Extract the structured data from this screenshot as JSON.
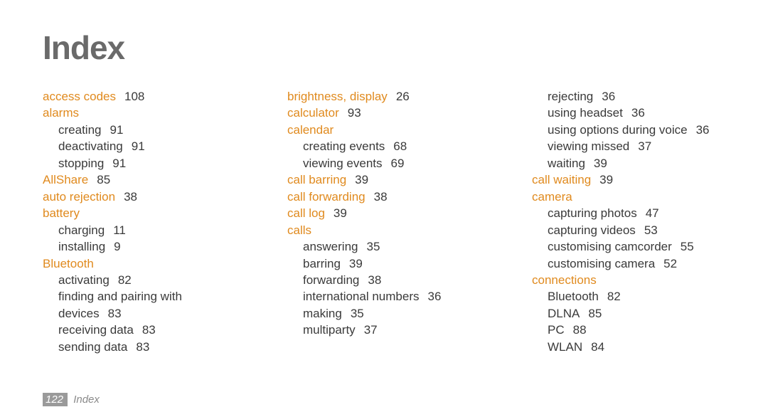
{
  "title": "Index",
  "footer": {
    "page": "122",
    "label": "Index"
  },
  "columns": [
    [
      {
        "type": "topic",
        "label": "access codes",
        "page": "108"
      },
      {
        "type": "topic",
        "label": "alarms"
      },
      {
        "type": "sub",
        "label": "creating",
        "page": "91"
      },
      {
        "type": "sub",
        "label": "deactivating",
        "page": "91"
      },
      {
        "type": "sub",
        "label": "stopping",
        "page": "91"
      },
      {
        "type": "topic",
        "label": "AllShare",
        "page": "85"
      },
      {
        "type": "topic",
        "label": "auto rejection",
        "page": "38"
      },
      {
        "type": "topic",
        "label": "battery"
      },
      {
        "type": "sub",
        "label": "charging",
        "page": "11"
      },
      {
        "type": "sub",
        "label": "installing",
        "page": "9"
      },
      {
        "type": "topic",
        "label": "Bluetooth"
      },
      {
        "type": "sub",
        "label": "activating",
        "page": "82"
      },
      {
        "type": "sub",
        "label": "finding and pairing with devices",
        "page": "83",
        "wrap": true
      },
      {
        "type": "sub",
        "label": "receiving data",
        "page": "83"
      },
      {
        "type": "sub",
        "label": "sending data",
        "page": "83"
      }
    ],
    [
      {
        "type": "topic",
        "label": "brightness, display",
        "page": "26"
      },
      {
        "type": "topic",
        "label": "calculator",
        "page": "93"
      },
      {
        "type": "topic",
        "label": "calendar"
      },
      {
        "type": "sub",
        "label": "creating events",
        "page": "68"
      },
      {
        "type": "sub",
        "label": "viewing events",
        "page": "69"
      },
      {
        "type": "topic",
        "label": "call barring",
        "page": "39"
      },
      {
        "type": "topic",
        "label": "call forwarding",
        "page": "38"
      },
      {
        "type": "topic",
        "label": "call log",
        "page": "39"
      },
      {
        "type": "topic",
        "label": "calls"
      },
      {
        "type": "sub",
        "label": "answering",
        "page": "35"
      },
      {
        "type": "sub",
        "label": "barring",
        "page": "39"
      },
      {
        "type": "sub",
        "label": "forwarding",
        "page": "38"
      },
      {
        "type": "sub",
        "label": "international numbers",
        "page": "36"
      },
      {
        "type": "sub",
        "label": "making",
        "page": "35"
      },
      {
        "type": "sub",
        "label": "multiparty",
        "page": "37"
      }
    ],
    [
      {
        "type": "sub",
        "label": "rejecting",
        "page": "36"
      },
      {
        "type": "sub",
        "label": "using headset",
        "page": "36"
      },
      {
        "type": "sub",
        "label": "using options during voice",
        "page": "36"
      },
      {
        "type": "sub",
        "label": "viewing missed",
        "page": "37"
      },
      {
        "type": "sub",
        "label": "waiting",
        "page": "39"
      },
      {
        "type": "topic",
        "label": "call waiting",
        "page": "39"
      },
      {
        "type": "topic",
        "label": "camera"
      },
      {
        "type": "sub",
        "label": "capturing photos",
        "page": "47"
      },
      {
        "type": "sub",
        "label": "capturing videos",
        "page": "53"
      },
      {
        "type": "sub",
        "label": "customising camcorder",
        "page": "55"
      },
      {
        "type": "sub",
        "label": "customising camera",
        "page": "52"
      },
      {
        "type": "topic",
        "label": "connections"
      },
      {
        "type": "sub",
        "label": "Bluetooth",
        "page": "82"
      },
      {
        "type": "sub",
        "label": "DLNA",
        "page": "85"
      },
      {
        "type": "sub",
        "label": "PC",
        "page": "88"
      },
      {
        "type": "sub",
        "label": "WLAN",
        "page": "84"
      }
    ]
  ]
}
